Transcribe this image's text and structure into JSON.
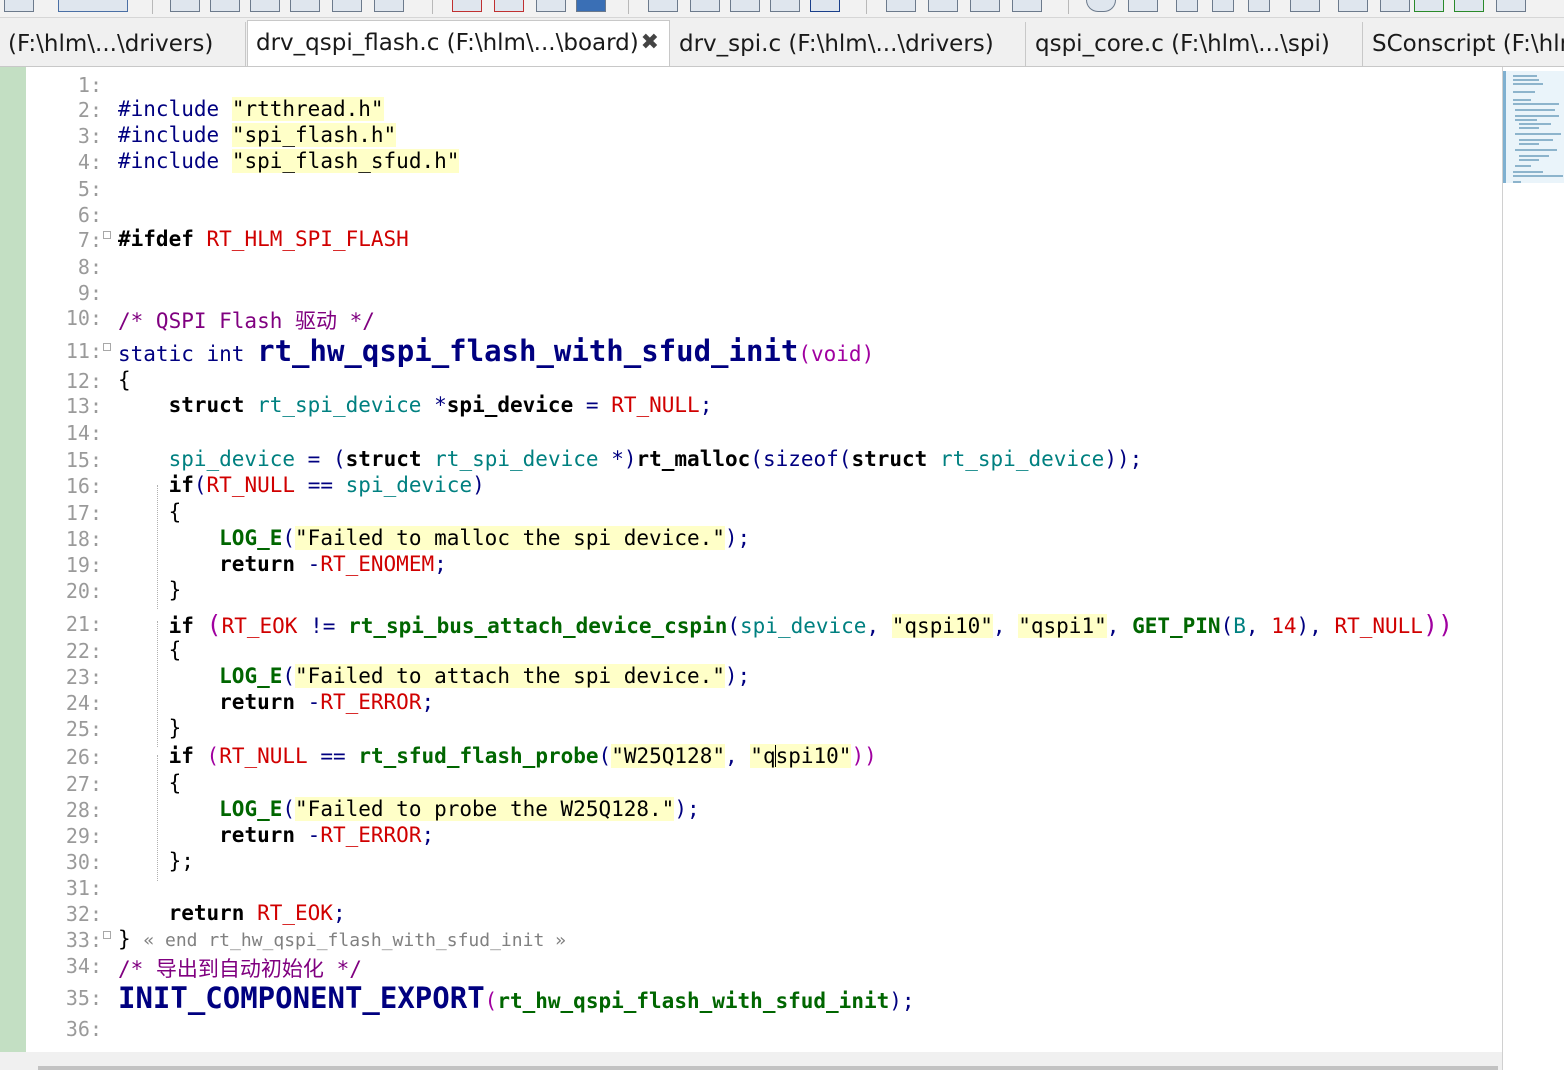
{
  "tabs": [
    {
      "label": "(F:\\hlm\\...\\drivers)",
      "active": false
    },
    {
      "label": "drv_qspi_flash.c (F:\\hlm\\...\\board)",
      "active": true,
      "close": "✖"
    },
    {
      "label": "drv_spi.c (F:\\hlm\\...\\drivers)",
      "active": false
    },
    {
      "label": "qspi_core.c (F:\\hlm\\...\\spi)",
      "active": false
    },
    {
      "label": "SConscript (F:\\hlm",
      "active": false
    }
  ],
  "editor": {
    "line_numbers": [
      "1:",
      "2:",
      "3:",
      "4:",
      "5:",
      "6:",
      "7:",
      "8:",
      "9:",
      "10:",
      "11:",
      "12:",
      "13:",
      "14:",
      "15:",
      "16:",
      "17:",
      "18:",
      "19:",
      "20:",
      "21:",
      "22:",
      "23:",
      "24:",
      "25:",
      "26:",
      "27:",
      "28:",
      "29:",
      "30:",
      "31:",
      "32:",
      "33:",
      "34:",
      "35:",
      "36:"
    ],
    "code": {
      "l2": {
        "kw": "#include",
        "str": "\"rtthread.h\""
      },
      "l3": {
        "kw": "#include",
        "str": "\"spi_flash.h\""
      },
      "l4": {
        "kw": "#include",
        "str": "\"spi_flash_sfud.h\""
      },
      "l7": {
        "kw": "#ifdef",
        "mac": "RT_HLM_SPI_FLASH"
      },
      "l10": {
        "comment": "/* QSPI Flash 驱动 */"
      },
      "l11": {
        "kw1": "static",
        "kw2": "int",
        "fn": "rt_hw_qspi_flash_with_sfud_init",
        "args": "(void)"
      },
      "l12": {
        "brace": "{"
      },
      "l13": {
        "kw": "struct",
        "type": "rt_spi_device",
        "star": "*",
        "var": "spi_device",
        "eq": "=",
        "mac": "RT_NULL",
        "semi": ";"
      },
      "l15": {
        "var": "spi_device",
        "eq": "=",
        "open": "(",
        "kw": "struct",
        "type": "rt_spi_device",
        "cast": "*)",
        "fn": "rt_malloc",
        "p1": "(",
        "sizeof": "sizeof",
        "p2": "(",
        "kw2": "struct",
        "type2": "rt_spi_device",
        "close": "));"
      },
      "l16": {
        "kw": "if",
        "open": "(",
        "mac": "RT_NULL",
        "op": "==",
        "var": "spi_device",
        "close": ")"
      },
      "l17": {
        "brace": "{"
      },
      "l18": {
        "fn": "LOG_E",
        "open": "(",
        "str": "\"Failed to malloc the spi device.\"",
        "close": ");"
      },
      "l19": {
        "kw": "return",
        "neg": "-",
        "mac": "RT_ENOMEM",
        "semi": ";"
      },
      "l20": {
        "brace": "}"
      },
      "l21": {
        "kw": "if",
        "open": "(",
        "mac": "RT_EOK",
        "op": "!=",
        "fn": "rt_spi_bus_attach_device_cspin",
        "p": "(",
        "var": "spi_device",
        "c1": ",",
        "s1": "\"qspi10\"",
        "c2": ",",
        "s2": "\"qspi1\"",
        "c3": ",",
        "fn2": "GET_PIN",
        "p2": "(",
        "a1": "B",
        "c4": ",",
        "num": "14",
        "p3": "),",
        "mac2": "RT_NULL",
        "close": "))"
      },
      "l22": {
        "brace": "{"
      },
      "l23": {
        "fn": "LOG_E",
        "open": "(",
        "str": "\"Failed to attach the spi device.\"",
        "close": ");"
      },
      "l24": {
        "kw": "return",
        "neg": "-",
        "mac": "RT_ERROR",
        "semi": ";"
      },
      "l25": {
        "brace": "}"
      },
      "l26": {
        "kw": "if",
        "open": "(",
        "mac": "RT_NULL",
        "op": "==",
        "fn": "rt_sfud_flash_probe",
        "p": "(",
        "s1": "\"W25Q128\"",
        "c1": ",",
        "s2a": "\"q",
        "s2b": "spi10\"",
        "close": "))"
      },
      "l27": {
        "brace": "{"
      },
      "l28": {
        "fn": "LOG_E",
        "open": "(",
        "str": "\"Failed to probe the W25Q128.\"",
        "close": ");"
      },
      "l29": {
        "kw": "return",
        "neg": "-",
        "mac": "RT_ERROR",
        "semi": ";"
      },
      "l30": {
        "brace": "};"
      },
      "l32": {
        "kw": "return",
        "mac": "RT_EOK",
        "semi": ";"
      },
      "l33": {
        "brace": "}",
        "end": "« end rt_hw_qspi_flash_with_sfud_init »"
      },
      "l34": {
        "comment": "/* 导出到自动初始化 */"
      },
      "l35": {
        "fn": "INIT_COMPONENT_EXPORT",
        "open": "(",
        "arg": "rt_hw_qspi_flash_with_sfud_init",
        "close": ");"
      }
    }
  }
}
